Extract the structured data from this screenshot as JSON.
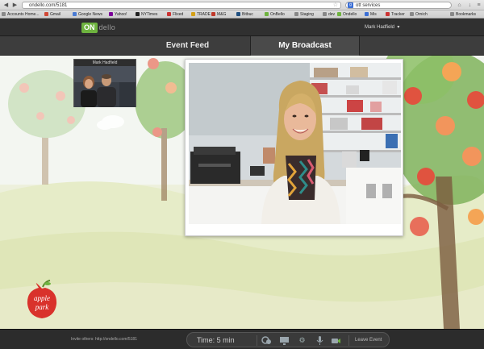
{
  "browser": {
    "url": "ondello.com/5181",
    "search_text": "ott services",
    "bookmarks": [
      {
        "label": "Accounts Home...",
        "color": "#888888"
      },
      {
        "label": "Gmail",
        "color": "#d14836"
      },
      {
        "label": "Google News",
        "color": "#4a7bd4"
      },
      {
        "label": "Yahoo!",
        "color": "#7b0099"
      },
      {
        "label": "NYTimes",
        "color": "#222222"
      },
      {
        "label": "Flixed",
        "color": "#cc3333"
      },
      {
        "label": "TRADE",
        "color": "#d4a017"
      },
      {
        "label": "M&G",
        "color": "#c0392b"
      },
      {
        "label": "Bitbuc",
        "color": "#205081"
      },
      {
        "label": "OnBello",
        "color": "#6eb33f"
      },
      {
        "label": "Staging",
        "color": "#888888"
      },
      {
        "label": "dev",
        "color": "#888888"
      },
      {
        "label": "Ondello",
        "color": "#6eb33f"
      },
      {
        "label": "Mis",
        "color": "#3b6fd6"
      },
      {
        "label": "Tracker",
        "color": "#cc3333"
      },
      {
        "label": "Ornich",
        "color": "#888888"
      },
      {
        "label": "Bookmarks",
        "color": "#888888"
      }
    ]
  },
  "app": {
    "logo_on": "ON",
    "logo_rest": "dello",
    "user_name": "Mark Hadfield",
    "tabs": [
      {
        "label": "Event Feed",
        "active": false
      },
      {
        "label": "My Broadcast",
        "active": true
      }
    ],
    "self_view_label": "Mark Hadfield",
    "brand_logo_line1": "apple",
    "brand_logo_line2": "park"
  },
  "footer": {
    "invite_text": "Invite others: http://ondello.com/5181",
    "timer": "Time: 5 min",
    "leave_label": "Leave Event"
  },
  "colors": {
    "accent_green": "#6eb33f",
    "apple_red": "#d9322b"
  }
}
